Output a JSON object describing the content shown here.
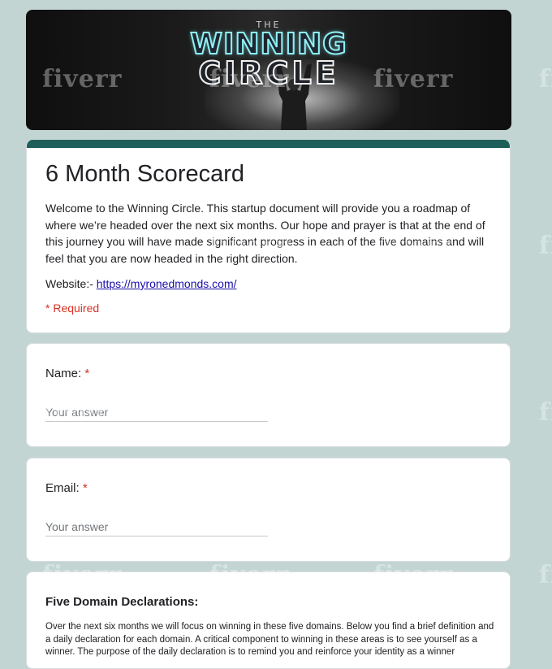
{
  "banner": {
    "the": "THE",
    "line1": "WINNING",
    "line2": "CIRCLE"
  },
  "watermark": "fiverr",
  "form": {
    "title": "6 Month Scorecard",
    "description": "Welcome to the Winning Circle. This startup document will provide you a roadmap of where we’re headed over the next six months. Our hope and prayer is that at the end of this journey you will have made significant progress in each of the five domains and will feel that you are now headed in the right direction.",
    "website_label": "Website:- ",
    "website_url": "https://myronedmonds.com/",
    "required_note": "* Required"
  },
  "questions": [
    {
      "label": "Name:",
      "required_mark": "*",
      "placeholder": "Your answer"
    },
    {
      "label": "Email:",
      "required_mark": "*",
      "placeholder": "Your answer"
    }
  ],
  "section": {
    "heading": "Five Domain Declarations:",
    "body": "Over the next six months we will focus on winning in these five domains. Below you find a brief definition and a daily declaration for each domain. A critical component to winning in these areas is to see yourself as a winner. The purpose of the daily declaration is to remind you and reinforce your identity as a winner"
  },
  "colors": {
    "background": "#c2d5d3",
    "accent_bar": "#1e5f5a",
    "required": "#d93025",
    "link": "#1a0dab"
  }
}
